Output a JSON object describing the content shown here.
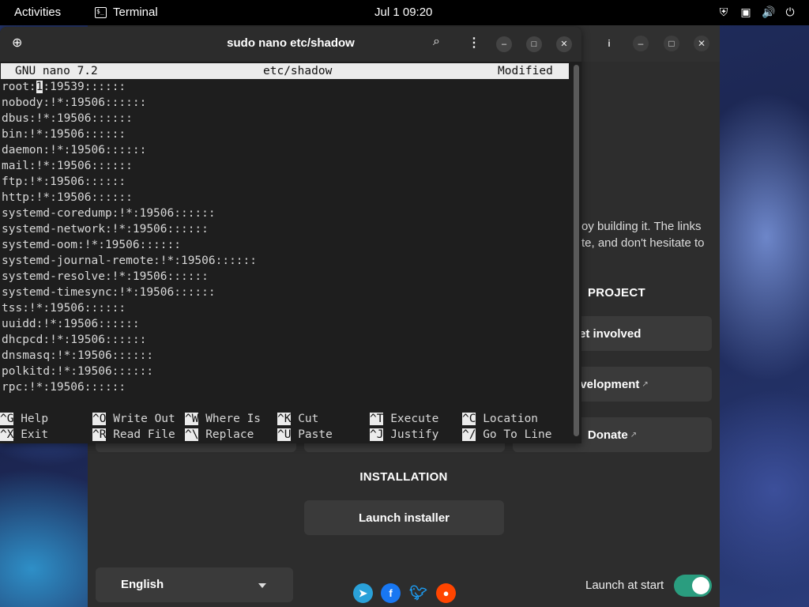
{
  "topbar": {
    "activities": "Activities",
    "app_name": "Terminal",
    "app_icon_glyph": "$_",
    "clock": "Jul 1  09:20",
    "tray_icons": [
      "privacy-indicator-icon",
      "network-icon",
      "volume-icon",
      "power-icon"
    ]
  },
  "terminal": {
    "title": "sudo nano etc/shadow"
  },
  "nano": {
    "version": "GNU nano 7.2",
    "filename": "etc/shadow",
    "status": "Modified",
    "first_line_prefix": "root:",
    "cursor_char": "1",
    "first_line_suffix": ":19539::::::",
    "lines": [
      "nobody:!*:19506::::::",
      "dbus:!*:19506::::::",
      "bin:!*:19506::::::",
      "daemon:!*:19506::::::",
      "mail:!*:19506::::::",
      "ftp:!*:19506::::::",
      "http:!*:19506::::::",
      "systemd-coredump:!*:19506::::::",
      "systemd-network:!*:19506::::::",
      "systemd-oom:!*:19506::::::",
      "systemd-journal-remote:!*:19506::::::",
      "systemd-resolve:!*:19506::::::",
      "systemd-timesync:!*:19506::::::",
      "tss:!*:19506::::::",
      "uuidd:!*:19506::::::",
      "dhcpcd:!*:19506::::::",
      "dnsmasq:!*:19506::::::",
      "polkitd:!*:19506::::::",
      "rpc:!*:19506::::::"
    ],
    "shortcuts": [
      {
        "key": "^G",
        "label": "Help"
      },
      {
        "key": "^O",
        "label": "Write Out"
      },
      {
        "key": "^W",
        "label": "Where Is"
      },
      {
        "key": "^K",
        "label": "Cut"
      },
      {
        "key": "^T",
        "label": "Execute"
      },
      {
        "key": "^C",
        "label": "Location"
      },
      {
        "key": "^X",
        "label": "Exit"
      },
      {
        "key": "^R",
        "label": "Read File"
      },
      {
        "key": "^\\",
        "label": "Replace"
      },
      {
        "key": "^U",
        "label": "Paste"
      },
      {
        "key": "^J",
        "label": "Justify"
      },
      {
        "key": "^/",
        "label": "Go To Line"
      }
    ]
  },
  "welcome": {
    "body_line1": "oy building it. The links",
    "body_line2": "te, and don't hesitate to",
    "project_title": "PROJECT",
    "get_involved": "et involved",
    "development": "evelopment",
    "donate": "Donate",
    "installation_title": "INSTALLATION",
    "launch_installer": "Launch installer",
    "language": "English",
    "launch_at_start": "Launch at start",
    "launch_at_start_on": true,
    "social_icons": [
      "telegram-icon",
      "facebook-icon",
      "twitter-icon",
      "reddit-icon"
    ]
  }
}
